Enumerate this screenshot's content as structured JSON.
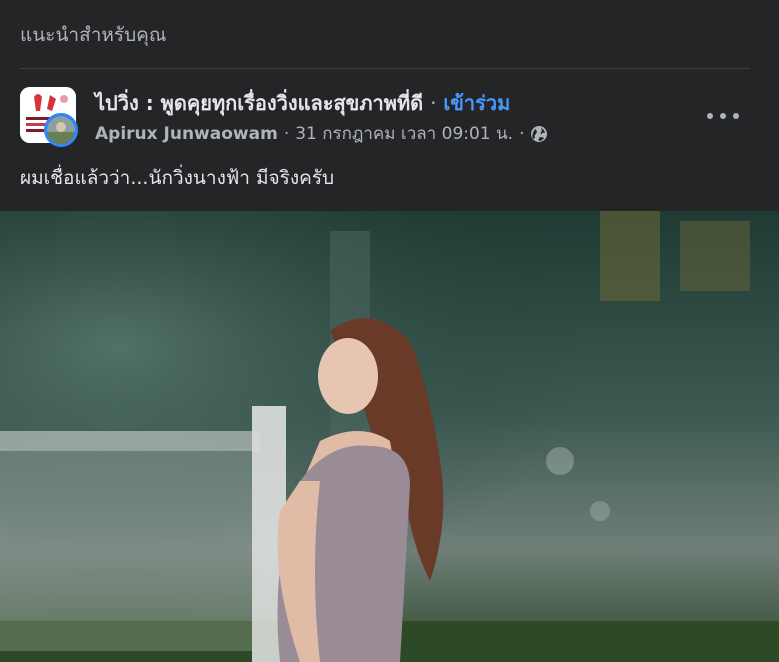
{
  "section": {
    "title": "แนะนำสำหรับคุณ"
  },
  "post": {
    "group_name": "ไปวิ่ง : พูดคุยทุกเรื่องวิ่งและสุขภาพที่ดี",
    "separator": "·",
    "join_label": "เข้าร่วม",
    "author": "Apirux Junwaowam",
    "timestamp": "31 กรกฎาคม เวลา 09:01 น.",
    "privacy_icon": "globe-icon",
    "text": "ผมเชื่อแล้วว่า...นักวิ่งนางฟ้า มีจริงครับ",
    "more_icon": "more-horizontal-icon"
  },
  "colors": {
    "background": "#242526",
    "text_primary": "#e4e6eb",
    "text_secondary": "#b0b3b8",
    "link": "#4599ff",
    "badge_ring": "#2d88ff"
  }
}
